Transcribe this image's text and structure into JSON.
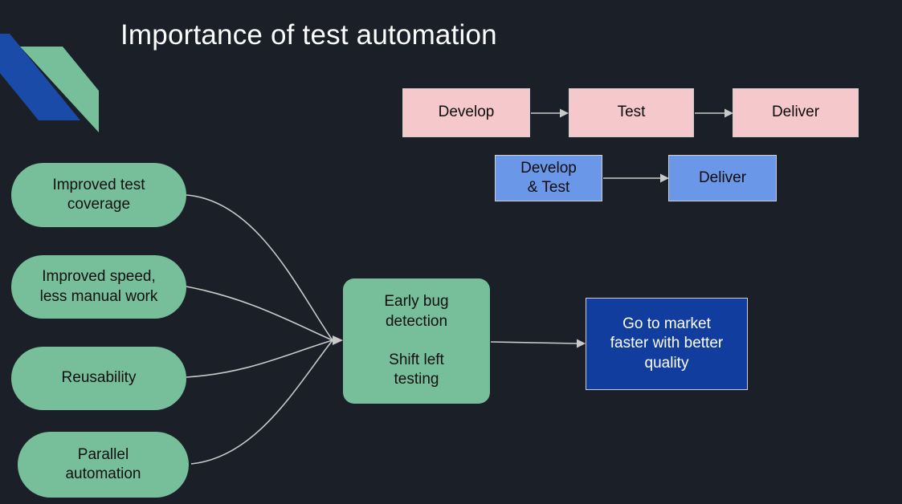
{
  "slide": {
    "title": "Importance of test automation",
    "background_color": "#1b2028"
  },
  "logo": {
    "name": "brand-parallelogram-logo",
    "blue_color": "#1b4ba8",
    "green_color": "#76bf9a"
  },
  "colors": {
    "pink": "#f5c8cb",
    "light_blue": "#6b97e8",
    "dark_blue": "#113d9e",
    "green": "#76bf9a",
    "connector": "#c9c9c9",
    "title_text": "#fdfdfd",
    "dark_text": "#101010",
    "light_text": "#ffffff"
  },
  "traditional_flow": {
    "label": "traditional-pipeline",
    "steps": [
      {
        "label": "Develop"
      },
      {
        "label": "Test"
      },
      {
        "label": "Deliver"
      }
    ]
  },
  "automated_flow": {
    "label": "automated-pipeline",
    "steps": [
      {
        "label": "Develop\n& Test"
      },
      {
        "label": "Deliver"
      }
    ]
  },
  "benefits": [
    {
      "label": "Improved test\ncoverage"
    },
    {
      "label": "Improved speed,\nless manual work"
    },
    {
      "label": "Reusability"
    },
    {
      "label": "Parallel\nautomation"
    }
  ],
  "outcome": {
    "label": "Early bug\ndetection\n\nShift left\ntesting"
  },
  "result": {
    "label": "Go to market\nfaster with better\nquality"
  }
}
